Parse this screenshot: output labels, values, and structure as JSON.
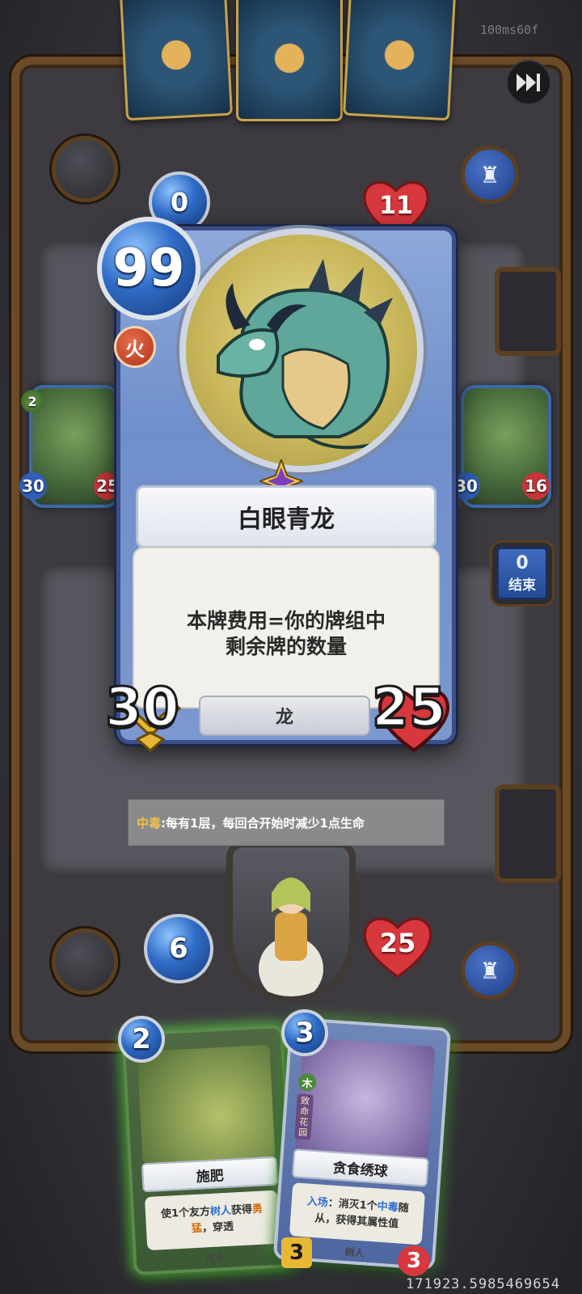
{
  "debug": {
    "latency": "100ms60f",
    "coords": "171923.5985469654"
  },
  "opponent": {
    "mana": "0",
    "health": "11"
  },
  "player": {
    "mana": "6",
    "health": "25"
  },
  "board": {
    "left_minion": {
      "cost": "2",
      "attack": "30",
      "health": "25"
    },
    "right_minion": {
      "attack": "30",
      "health": "16"
    }
  },
  "end_turn": {
    "count": "0",
    "label": "结束"
  },
  "detail_card": {
    "cost": "99",
    "element": "火",
    "name": "白眼青龙",
    "description_line1": "本牌费用=你的牌组中",
    "description_line2": "剩余牌的数量",
    "attack": "30",
    "health": "25",
    "race": "龙"
  },
  "tooltip": {
    "keyword": "中毒",
    "text": ":每有1层，每回合开始时减少1点生命"
  },
  "hand": [
    {
      "cost": "2",
      "name": "施肥",
      "desc_pre": "使1个友方",
      "desc_hl1": "树人",
      "desc_mid": "获得",
      "desc_hl2": "勇猛",
      "desc_post": "，穿透",
      "type": "咒术"
    },
    {
      "cost": "3",
      "element": "木",
      "tag": "致命花园",
      "name": "贪食绣球",
      "desc_hl1": "入场",
      "desc_pre": "：消灭1个",
      "desc_hl2": "中毒",
      "desc_post": "随从，获得其属性值",
      "type": "树人",
      "attack": "3",
      "health": "3"
    }
  ],
  "colors": {
    "mana_blue": "#2f6bc6",
    "health_red": "#d7383d",
    "attack_gold": "#e8b733",
    "hand_glow": "#60dc46",
    "keyword_yellow": "#f2c24a"
  }
}
